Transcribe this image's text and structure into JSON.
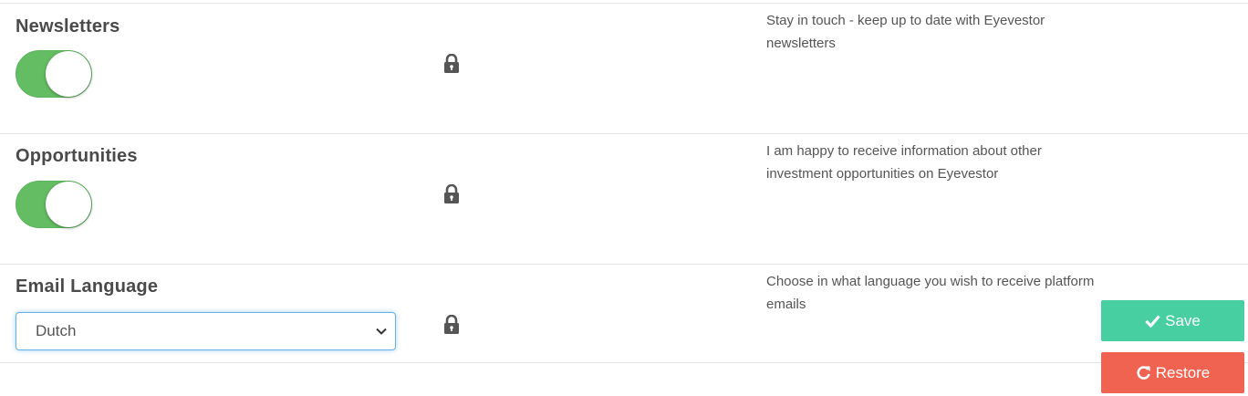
{
  "settings": {
    "newsletters": {
      "title": "Newsletters",
      "enabled": true,
      "description": "Stay in touch - keep up to date with Eyevestor newsletters"
    },
    "opportunities": {
      "title": "Opportunities",
      "enabled": true,
      "description": "I am happy to receive information about other investment opportunities on Eyevestor"
    },
    "email_language": {
      "title": "Email Language",
      "selected": "Dutch",
      "description": "Choose in what language you wish to receive platform emails"
    }
  },
  "actions": {
    "save_label": "Save",
    "restore_label": "Restore"
  },
  "icons": {
    "lock": "lock-icon",
    "save": "check-icon",
    "restore": "refresh-icon",
    "dropdown": "chevron-down-icon"
  },
  "colors": {
    "toggle_on": "#64bd63",
    "save_button": "#47cfa1",
    "restore_button": "#f06351",
    "focus_border": "#66afe9"
  }
}
